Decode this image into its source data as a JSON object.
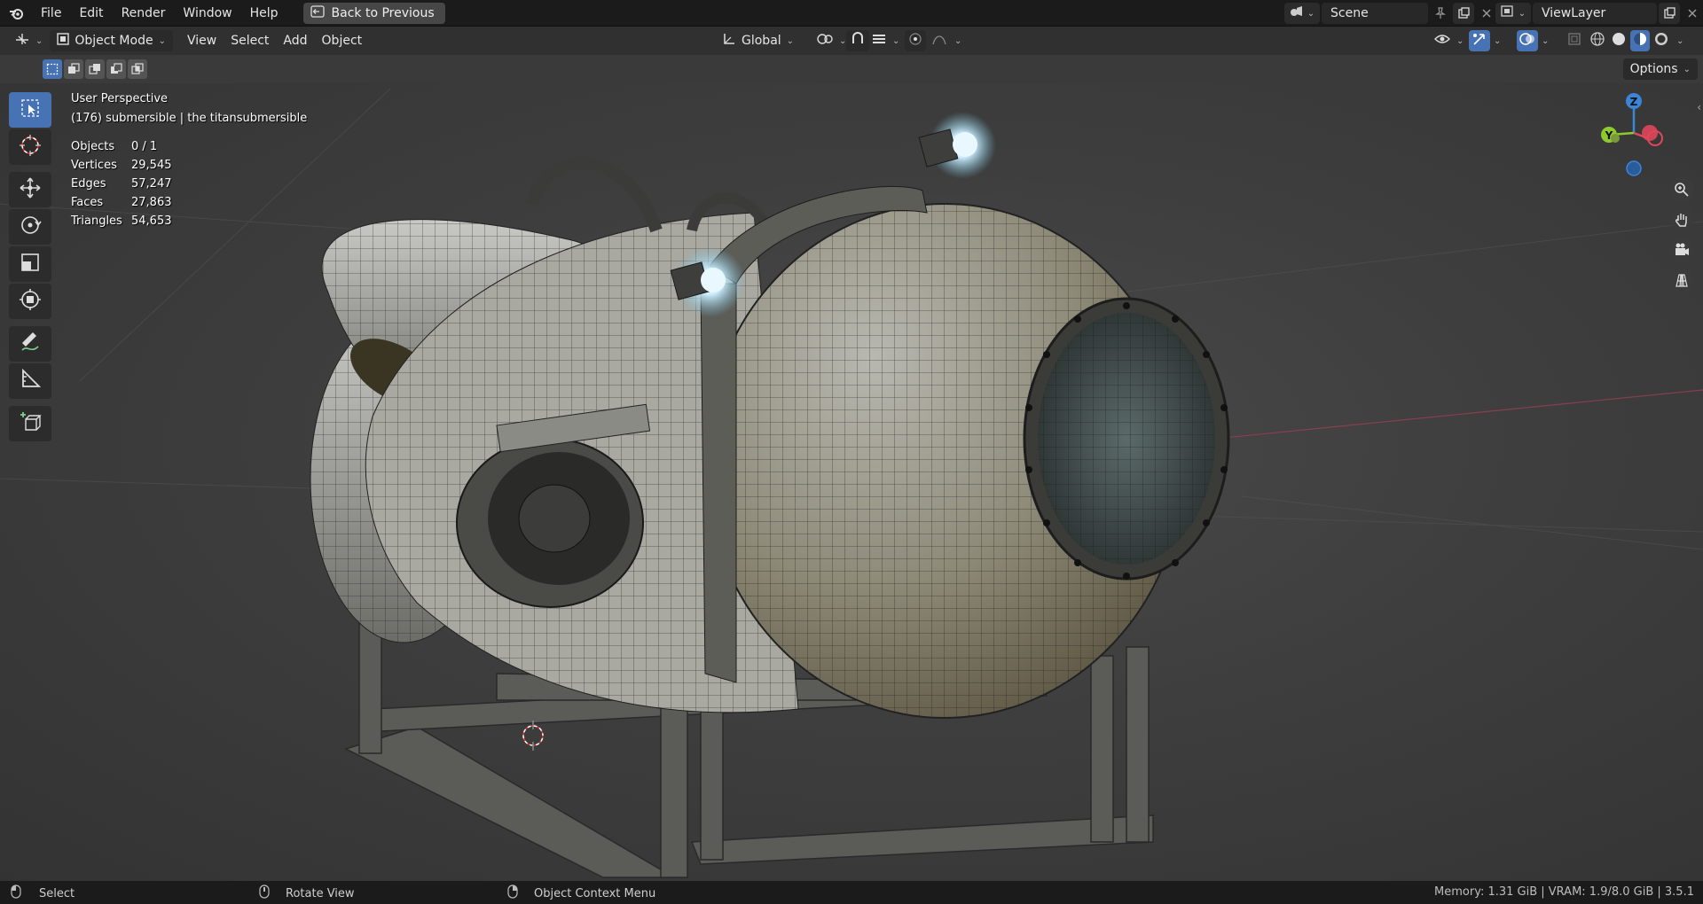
{
  "menu": {
    "items": [
      "File",
      "Edit",
      "Render",
      "Window",
      "Help"
    ],
    "back_label": "Back to Previous"
  },
  "scene": {
    "name": "Scene"
  },
  "view_layer": {
    "name": "ViewLayer"
  },
  "header": {
    "mode": "Object Mode",
    "view": "View",
    "select": "Select",
    "add": "Add",
    "object": "Object",
    "orientation": "Global"
  },
  "options_label": "Options",
  "overlay": {
    "view_name": "User Perspective",
    "object_info": "(176) submersible | the titansubmersible",
    "stats": [
      {
        "label": "Objects",
        "value": "0 / 1"
      },
      {
        "label": "Vertices",
        "value": "29,545"
      },
      {
        "label": "Edges",
        "value": "57,247"
      },
      {
        "label": "Faces",
        "value": "27,863"
      },
      {
        "label": "Triangles",
        "value": "54,653"
      }
    ]
  },
  "gizmo": {
    "z": "Z",
    "y": "Y"
  },
  "status": {
    "left_1": "Select",
    "left_2": "Rotate View",
    "left_3": "Object Context Menu",
    "right": "Memory: 1.31 GiB | VRAM: 1.9/8.0 GiB | 3.5.1"
  },
  "colors": {
    "accent": "#4772b3",
    "x_axis": "#e0475a",
    "y_axis": "#8ec92e",
    "z_axis": "#3a85d8"
  }
}
